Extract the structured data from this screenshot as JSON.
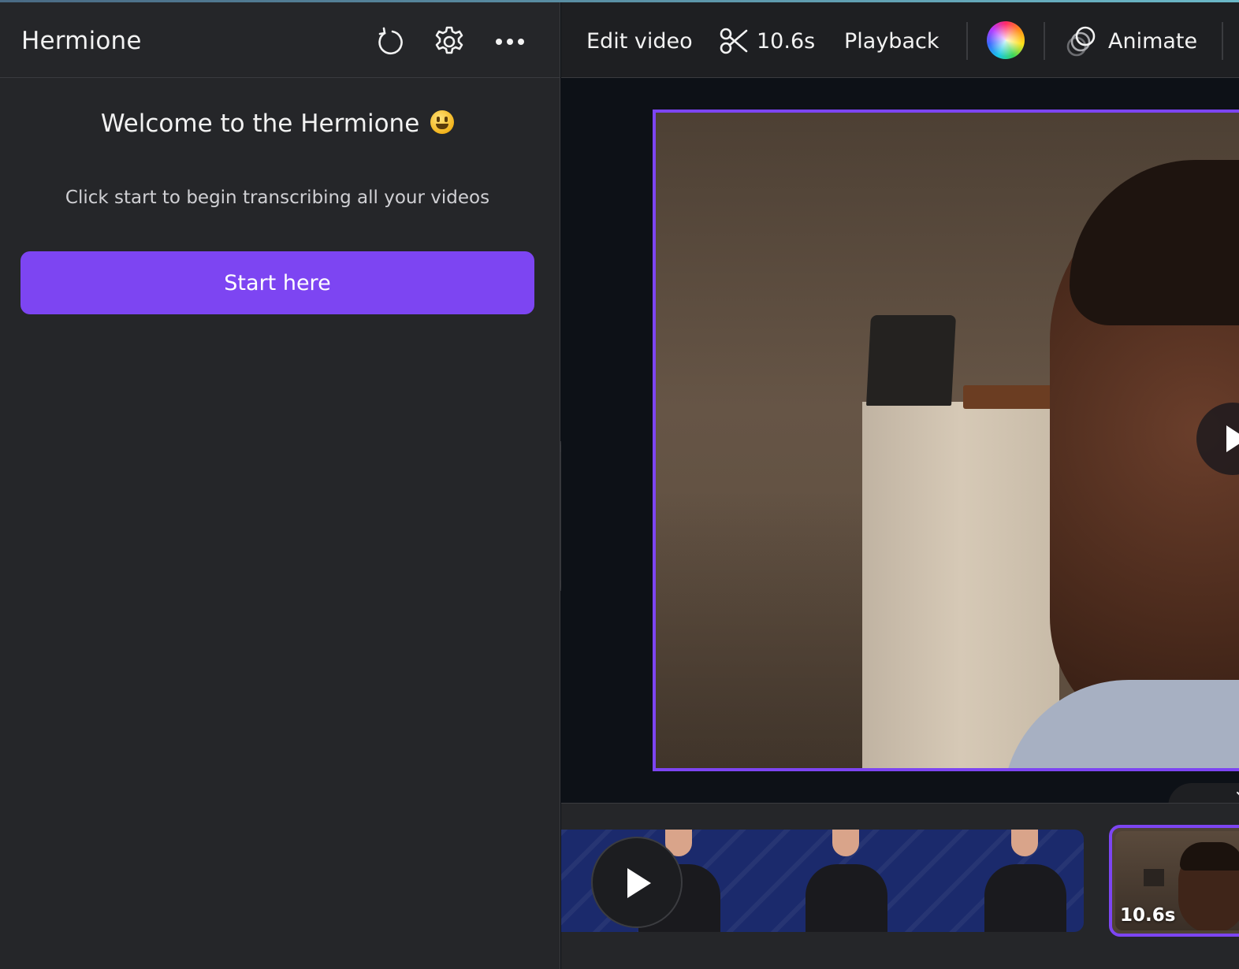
{
  "sidebar": {
    "app_title": "Hermione",
    "icons": [
      "refresh-icon",
      "gear-icon",
      "more-icon"
    ],
    "welcome_text": "Welcome to the Hermione",
    "welcome_emoji": "grinning-face-emoji",
    "subtitle": "Click start to begin transcribing all your videos",
    "start_button_label": "Start here"
  },
  "toolbar": {
    "edit_video_label": "Edit video",
    "trim_duration": "10.6s",
    "playback_label": "Playback",
    "animate_label": "Animate"
  },
  "timeline": {
    "clip2_duration": "10.6s"
  },
  "colors": {
    "accent": "#7d45f2",
    "panel_bg": "#252629",
    "canvas_bg": "#0d1117"
  }
}
